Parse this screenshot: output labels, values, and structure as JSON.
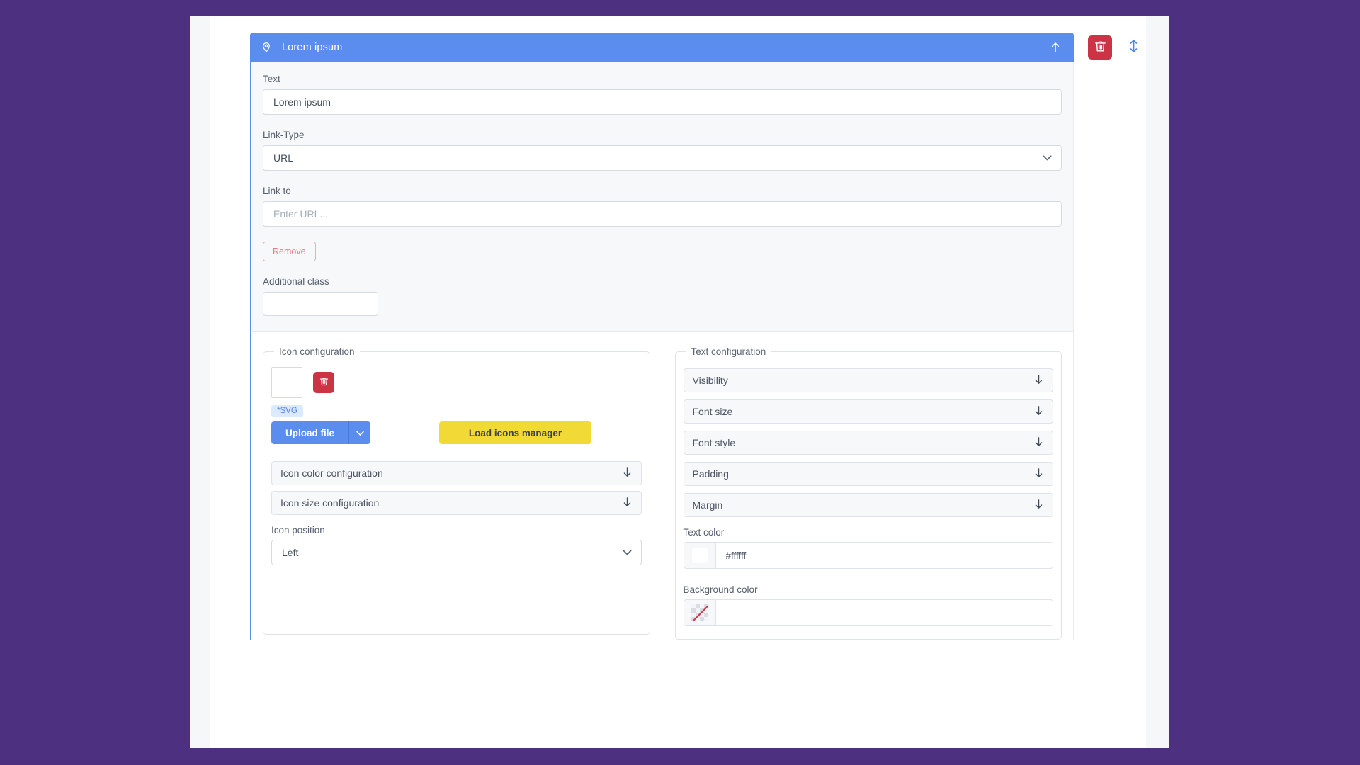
{
  "theme": {
    "page_background": "#4e3080",
    "accent_blue": "#5b8def",
    "danger_red": "#cc3344",
    "warning_yellow": "#f2da36",
    "panel_gray": "#f7f8fa",
    "surface_white": "#ffffff",
    "border_gray": "#dfe3e9"
  },
  "card": {
    "header": {
      "icon": "map-marker-icon",
      "title": "Lorem ipsum",
      "collapse_icon": "arrow-up-icon"
    },
    "actions": {
      "delete_icon": "trash-icon",
      "reorder_icon": "arrows-up-down-icon"
    }
  },
  "upper": {
    "text": {
      "label": "Text",
      "value": "Lorem ipsum"
    },
    "link_type": {
      "label": "Link-Type",
      "value": "URL",
      "options": [
        "URL"
      ],
      "chevron_icon": "chevron-down-icon"
    },
    "link_to": {
      "label": "Link to",
      "value": "",
      "placeholder": "Enter URL..."
    },
    "remove_button": {
      "label": "Remove"
    },
    "additional_class": {
      "label": "Additional class",
      "value": ""
    }
  },
  "icon_config": {
    "legend": "Icon configuration",
    "preview": "icon-preview-empty",
    "delete_icon": "trash-icon",
    "svg_badge": "*SVG",
    "upload_button": {
      "label": "Upload file",
      "caret_icon": "chevron-down-icon"
    },
    "load_icons_button": {
      "label": "Load icons manager"
    },
    "accordions": [
      {
        "label": "Icon color configuration",
        "icon": "arrow-down-icon"
      },
      {
        "label": "Icon size configuration",
        "icon": "arrow-down-icon"
      }
    ],
    "icon_position": {
      "label": "Icon position",
      "value": "Left",
      "options": [
        "Left"
      ],
      "chevron_icon": "chevron-down-icon"
    }
  },
  "text_config": {
    "legend": "Text configuration",
    "accordions": [
      {
        "label": "Visibility",
        "icon": "arrow-down-icon"
      },
      {
        "label": "Font size",
        "icon": "arrow-down-icon"
      },
      {
        "label": "Font style",
        "icon": "arrow-down-icon"
      },
      {
        "label": "Padding",
        "icon": "arrow-down-icon"
      },
      {
        "label": "Margin",
        "icon": "arrow-down-icon"
      }
    ],
    "text_color": {
      "label": "Text color",
      "value": "#ffffff",
      "swatch": "#ffffff"
    },
    "background_color": {
      "label": "Background color",
      "value": "",
      "placeholder": "",
      "swatch": "transparent"
    }
  }
}
